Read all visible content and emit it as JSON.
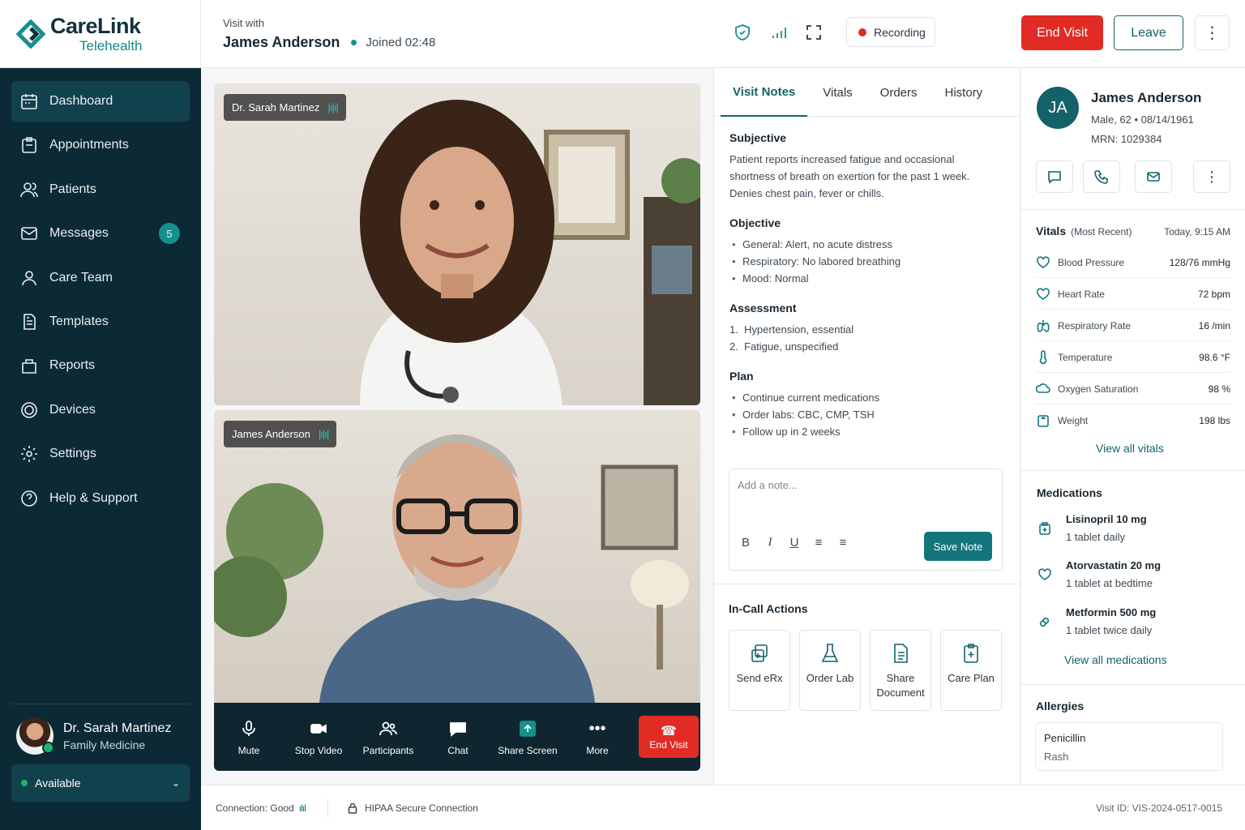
{
  "brand": {
    "name": "CareLink",
    "sub": "Telehealth",
    "accent": "#14908f"
  },
  "sidebar": {
    "items": [
      {
        "label": "Dashboard",
        "icon": "calendar-icon",
        "active": true
      },
      {
        "label": "Appointments",
        "icon": "clipboard-icon"
      },
      {
        "label": "Patients",
        "icon": "users-icon"
      },
      {
        "label": "Messages",
        "icon": "mail-icon",
        "badge": "5"
      },
      {
        "label": "Care Team",
        "icon": "team-icon"
      },
      {
        "label": "Templates",
        "icon": "document-icon"
      },
      {
        "label": "Reports",
        "icon": "report-icon"
      },
      {
        "label": "Devices",
        "icon": "device-icon"
      },
      {
        "label": "Settings",
        "icon": "gear-icon"
      },
      {
        "label": "Help & Support",
        "icon": "help-icon"
      }
    ],
    "profile": {
      "name": "Dr. Sarah Martinez",
      "role": "Family Medicine",
      "status": "Available"
    }
  },
  "header": {
    "visit_with": "Visit with",
    "patient_name": "James Anderson",
    "joined": "Joined 02:48",
    "recording": "Recording",
    "end_visit": "End Visit",
    "leave": "Leave"
  },
  "video": {
    "doctor_tag": "Dr. Sarah Martinez",
    "patient_tag": "James Anderson",
    "controls": [
      {
        "label": "Mute",
        "icon": "microphone-icon"
      },
      {
        "label": "Stop Video",
        "icon": "camera-icon"
      },
      {
        "label": "Participants",
        "icon": "participants-icon"
      },
      {
        "label": "Chat",
        "icon": "chat-icon"
      },
      {
        "label": "Share Screen",
        "icon": "share-screen-icon"
      },
      {
        "label": "More",
        "icon": "more-icon"
      }
    ],
    "end_visit": "End Visit"
  },
  "notes": {
    "tabs": [
      "Visit Notes",
      "Vitals",
      "Orders",
      "History"
    ],
    "subjective": {
      "title": "Subjective",
      "lines": [
        "Patient reports increased fatigue and occasional",
        "shortness of breath on exertion for the past 1 week.",
        "Denies chest pain, fever or chills."
      ]
    },
    "objective": {
      "title": "Objective",
      "items": [
        "General: Alert, no acute distress",
        "Respiratory: No labored breathing",
        "Mood: Normal"
      ]
    },
    "assessment": {
      "title": "Assessment",
      "items": [
        {
          "n": "1.",
          "text": "Hypertension, essential"
        },
        {
          "n": "2.",
          "text": "Fatigue, unspecified"
        }
      ]
    },
    "plan": {
      "title": "Plan",
      "items": [
        "Continue current medications",
        "Order labs: CBC, CMP, TSH",
        "Follow up in 2 weeks"
      ]
    },
    "input_placeholder": "Add a note...",
    "save": "Save Note",
    "actions_title": "In-Call Actions",
    "actions": [
      {
        "label": "Send eRx",
        "icon": "erx-icon"
      },
      {
        "label": "Order Lab",
        "icon": "flask-icon"
      },
      {
        "label": "Share Document",
        "icon": "document-icon"
      },
      {
        "label": "Care Plan",
        "icon": "clipboard-plus-icon"
      }
    ]
  },
  "patient": {
    "initials": "JA",
    "name": "James Anderson",
    "meta": "Male, 62  •  08/14/1961",
    "mrn": "MRN: 1029384",
    "vitals_title": "Vitals",
    "vitals_sub": "(Most Recent)",
    "vitals_date": "Today, 9:15 AM",
    "vitals": [
      {
        "label": "Blood Pressure",
        "value": "128/76 mmHg",
        "icon": "blood-pressure-icon"
      },
      {
        "label": "Heart Rate",
        "value": "72 bpm",
        "icon": "heart-icon"
      },
      {
        "label": "Respiratory Rate",
        "value": "16 /min",
        "icon": "lungs-icon"
      },
      {
        "label": "Temperature",
        "value": "98.6 °F",
        "icon": "thermometer-icon"
      },
      {
        "label": "Oxygen Saturation",
        "value": "98 %",
        "icon": "oxygen-icon"
      },
      {
        "label": "Weight",
        "value": "198 lbs",
        "icon": "scale-icon"
      }
    ],
    "view_vitals": "View all vitals",
    "meds_title": "Medications",
    "meds": [
      {
        "name": "Lisinopril 10 mg",
        "dose": "1 tablet daily",
        "icon": "pill-icon"
      },
      {
        "name": "Atorvastatin 20 mg",
        "dose": "1 tablet at bedtime",
        "icon": "heart-pill-icon"
      },
      {
        "name": "Metformin 500 mg",
        "dose": "1 tablet twice daily",
        "icon": "capsule-icon"
      }
    ],
    "view_meds": "View all medications",
    "allergies_title": "Allergies",
    "allergy": {
      "name": "Penicillin",
      "reaction": "Rash"
    }
  },
  "footer": {
    "connection": "Connection: Good",
    "hipaa": "HIPAA Secure Connection",
    "visit_id": "Visit ID: VIS-2024-0517-0015"
  }
}
